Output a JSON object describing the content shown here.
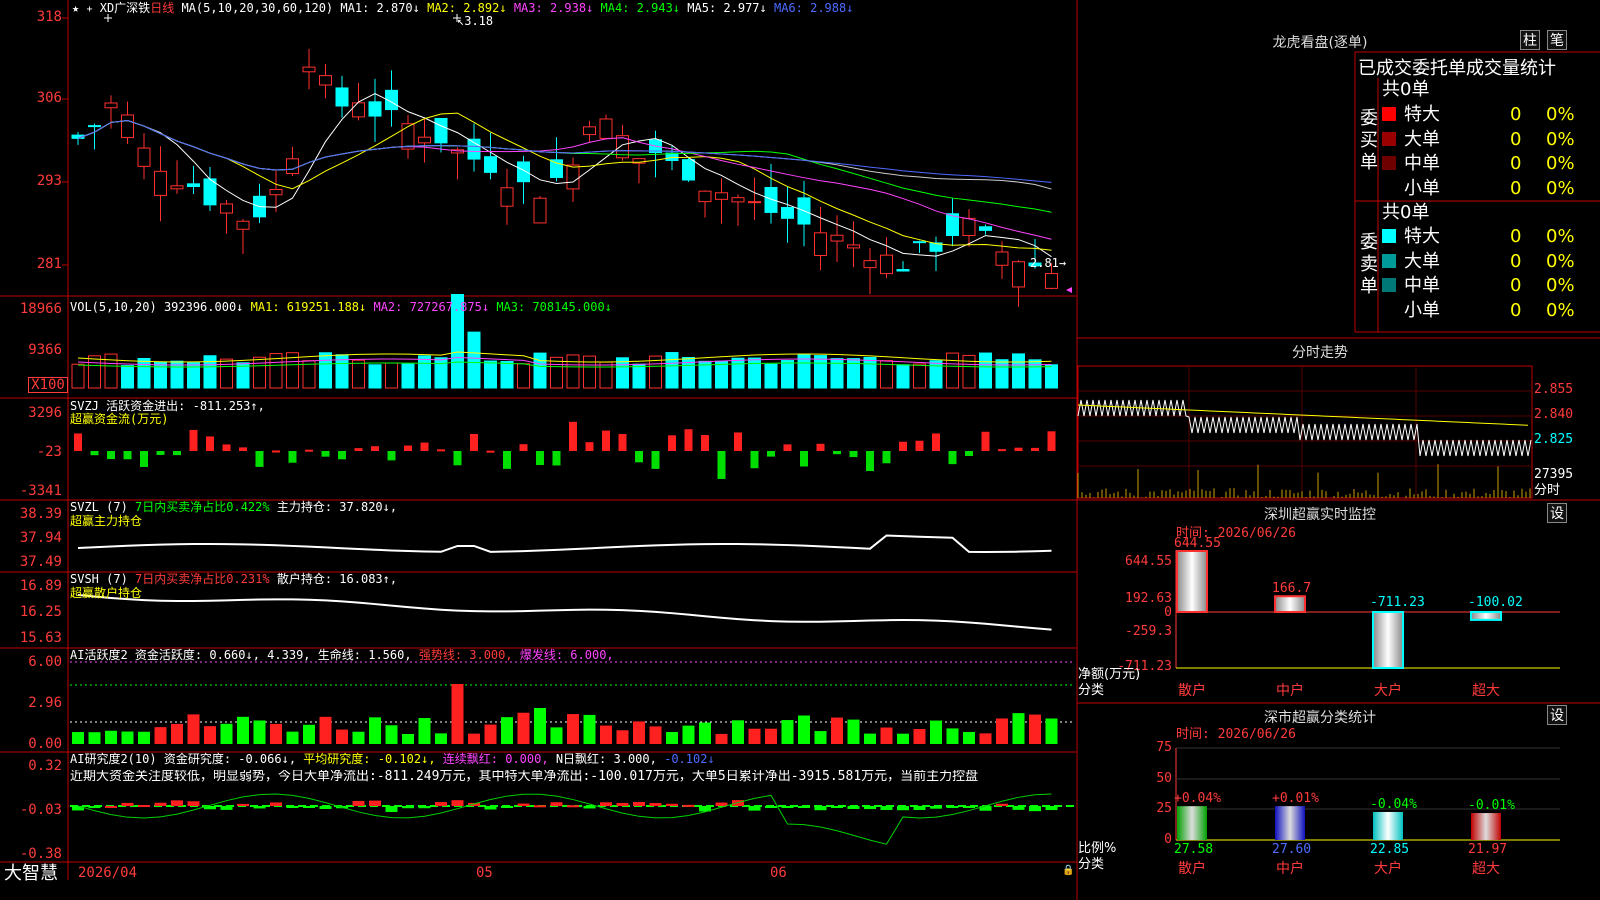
{
  "left": {
    "main": {
      "symbol": "XD广深铁",
      "period": "日线",
      "ma_header": "MA(5,10,20,30,60,120)",
      "ma1": "MA1: 2.870↓",
      "ma2": "MA2: 2.892↓",
      "ma3": "MA3: 2.938↓",
      "ma4": "MA4: 2.943↓",
      "ma5": "MA5: 2.977↓",
      "ma6": "MA6: 2.988↓",
      "high_label": "3.18",
      "low_label": "2.81",
      "axis": [
        "318",
        "306",
        "293",
        "281"
      ]
    },
    "vol": {
      "header": "VOL(5,10,20)",
      "value": "392396.000↓",
      "ma1": "MA1: 619251.188↓",
      "ma2": "MA2: 727267.875↓",
      "ma3": "MA3: 708145.000↓",
      "axis": [
        "18966",
        "9366",
        "X100"
      ]
    },
    "svzj": {
      "header": "SVZJ",
      "active": "活跃资金进出: -811.253↑,",
      "sub": "超赢资金流(万元)",
      "axis": [
        "3296",
        "-23",
        "-3341"
      ]
    },
    "svzl": {
      "header": "SVZL (7)",
      "ratio": "7日内买卖净占比0.422%",
      "holding": "主力持仓: 37.820↓,",
      "sub": "超赢主力持仓",
      "axis": [
        "38.39",
        "37.94",
        "37.49"
      ]
    },
    "svsh": {
      "header": "SVSH (7)",
      "ratio": "7日内买卖净占比0.231%",
      "holding": "散户持仓: 16.083↑,",
      "sub": "超赢散户持仓",
      "axis": [
        "16.89",
        "16.25",
        "15.63"
      ]
    },
    "ai_active": {
      "header": "AI活跃度2",
      "value": "资金活跃度: 0.660↓, 4.339,",
      "life": "生命线: 1.560,",
      "strong": "强势线: 3.000,",
      "burst": "爆发线: 6.000,",
      "axis": [
        "6.00",
        "2.96",
        "0.00"
      ]
    },
    "ai_research": {
      "header": "AI研究度2(10)",
      "value": "资金研究度: -0.066↓,",
      "avg": "平均研究度: -0.102↓,",
      "streak": "连续飘红: 0.000,",
      "nday": "N日飘红: 3.000,",
      "last": "-0.102↓",
      "commentary": "近期大资金关注度较低，明显弱势，今日大单净流出:-811.249万元，其中特大单净流出:-100.017万元，大单5日累计净出-3915.581万元，当前主力控盘",
      "axis": [
        "0.32",
        "-0.03",
        "-0.38"
      ]
    },
    "footer": {
      "brand": "大智慧",
      "date": "2026/04",
      "m05": "05",
      "m06": "06"
    }
  },
  "right": {
    "longhu": {
      "title": "龙虎看盘(逐单)",
      "btn_zhu": "柱",
      "btn_bi": "笔",
      "stats_title": "已成交委托单成交量统计",
      "buy_label": "委买单",
      "sell_label": "委卖单",
      "buy_total": "共0单",
      "sell_total": "共0单",
      "buy_rows": [
        {
          "name": "特大",
          "count": "0",
          "pct": "0%",
          "color": "#ff0000"
        },
        {
          "name": "大单",
          "count": "0",
          "pct": "0%",
          "color": "#9a0000"
        },
        {
          "name": "中单",
          "count": "0",
          "pct": "0%",
          "color": "#6e0000"
        },
        {
          "name": "小单",
          "count": "0",
          "pct": "0%",
          "color": "#000000"
        }
      ],
      "sell_rows": [
        {
          "name": "特大",
          "count": "0",
          "pct": "0%",
          "color": "#00ffff"
        },
        {
          "name": "大单",
          "count": "0",
          "pct": "0%",
          "color": "#009a9a"
        },
        {
          "name": "中单",
          "count": "0",
          "pct": "0%",
          "color": "#007878"
        },
        {
          "name": "小单",
          "count": "0",
          "pct": "0%",
          "color": "#000000"
        }
      ]
    },
    "intraday": {
      "title": "分时走势",
      "axis": [
        "2.855",
        "2.840",
        "2.825",
        "27395"
      ],
      "unit": "分时"
    },
    "sz_monitor": {
      "title": "深圳超赢实时监控",
      "btn": "设",
      "time": "时间: 2026/06/26",
      "axis": [
        "644.55",
        "192.63",
        "0",
        "-259.3",
        "-711.23"
      ],
      "ylabel": "净额(万元)",
      "xlabel": "分类",
      "bars": [
        {
          "cat": "散户",
          "label": "644.55",
          "value": 644.55
        },
        {
          "cat": "中户",
          "label": "166.7",
          "value": 166.7
        },
        {
          "cat": "大户",
          "label": "-711.23",
          "value": -711.23
        },
        {
          "cat": "超大",
          "label": "-100.02",
          "value": -100.02
        }
      ]
    },
    "sz_class": {
      "title": "深市超赢分类统计",
      "btn": "设",
      "time": "时间: 2026/06/26",
      "axis": [
        "75",
        "50",
        "25",
        "0"
      ],
      "ylabel": "比例%",
      "xlabel": "分类",
      "bars": [
        {
          "cat": "散户",
          "pct": "+0.04%",
          "value": 27.58,
          "label": "27.58"
        },
        {
          "cat": "中户",
          "pct": "+0.01%",
          "value": 27.6,
          "label": "27.60"
        },
        {
          "cat": "大户",
          "pct": "-0.04%",
          "value": 22.85,
          "label": "22.85"
        },
        {
          "cat": "超大",
          "pct": "-0.01%",
          "value": 21.97,
          "label": "21.97"
        }
      ]
    }
  }
}
